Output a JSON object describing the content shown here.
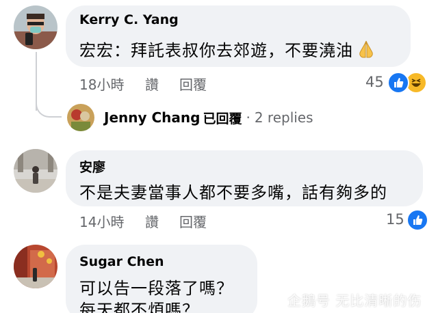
{
  "comments": [
    {
      "author": "Kerry C. Yang",
      "text": "宏宏：拜託表叔你去郊遊，不要澆油",
      "time": "18小時",
      "like_label": "讚",
      "reply_label": "回覆",
      "reaction_count": "45"
    },
    {
      "author": "安廖",
      "text": "不是夫妻當事人都不要多嘴，話有夠多的",
      "time": "14小時",
      "like_label": "讚",
      "reply_label": "回覆",
      "reaction_count": "15"
    },
    {
      "author": "Sugar Chen",
      "text_line1": "可以告一段落了嗎？",
      "text_line2": "每天都不煩嗎？…"
    }
  ],
  "reply_summary": {
    "name": "Jenny Chang",
    "action": "已回覆",
    "separator": "·",
    "replies": "2 replies"
  },
  "watermark": "企鵝号 无比清晰的伤",
  "colors": {
    "bubble": "#f0f2f5",
    "meta_text": "#65676b",
    "like_blue": "#1877f2",
    "haha_yellow": "#f7b928"
  },
  "icons": [
    "pray-emoji-icon",
    "like-reaction-icon",
    "haha-reaction-icon",
    "penguin-logo-icon"
  ]
}
